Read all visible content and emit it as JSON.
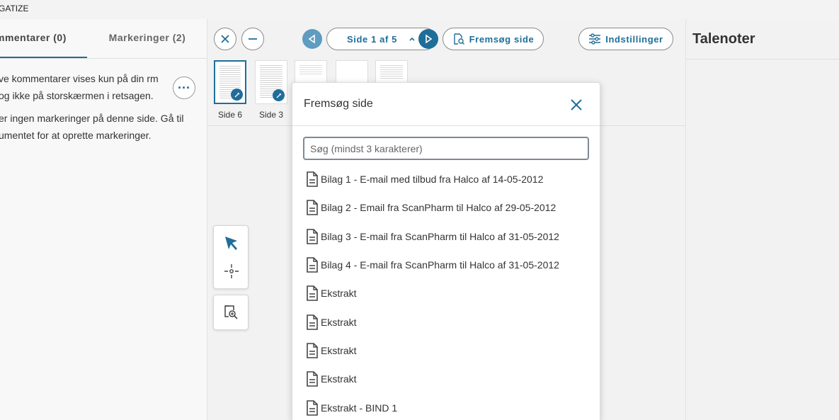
{
  "app": {
    "title_fragment": "GATIZE"
  },
  "left_panel": {
    "tabs": [
      {
        "label": "mmentarer (0)"
      },
      {
        "label": "Markeringer (2)"
      }
    ],
    "info_text_1": "ve kommentarer vises kun på din rm og ikke på storskærmen i retsagen.",
    "info_text_2": "er ingen markeringer på denne side. Gå til umentet for at oprette markeringer."
  },
  "toolbar": {
    "page_indicator": "Side 1 af 5",
    "search_page_label": "Fremsøg side",
    "settings_label": "Indstillinger",
    "accent_color": "#1f6e99"
  },
  "thumbnails": [
    {
      "label": "Side 6",
      "selected": true,
      "annotated": true
    },
    {
      "label": "Side 3",
      "selected": false,
      "annotated": true
    },
    {
      "label": "",
      "selected": false,
      "annotated": false
    },
    {
      "label": "",
      "selected": false,
      "annotated": false
    },
    {
      "label": "",
      "selected": false,
      "annotated": false
    }
  ],
  "tools": {
    "pointer_icon": "pointer-arrow-icon",
    "crosshair_icon": "crosshair-icon",
    "zoom_page_icon": "zoom-page-icon"
  },
  "right_panel": {
    "title": "Talenoter"
  },
  "dialog": {
    "title": "Fremsøg side",
    "search_placeholder": "Søg (mindst 3 karakterer)",
    "search_value": "",
    "results": [
      {
        "label": "Bilag 1 - E-mail med tilbud fra Halco af 14-05-2012"
      },
      {
        "label": "Bilag 2 - Email fra ScanPharm til Halco af 29-05-2012"
      },
      {
        "label": "Bilag 3 - E-mail fra ScanPharm til Halco af 31-05-2012"
      },
      {
        "label": "Bilag 4 - E-mail fra ScanPharm til Halco af 31-05-2012"
      },
      {
        "label": "Ekstrakt"
      },
      {
        "label": "Ekstrakt"
      },
      {
        "label": "Ekstrakt"
      },
      {
        "label": "Ekstrakt"
      },
      {
        "label": "Ekstrakt - BIND 1"
      }
    ]
  }
}
